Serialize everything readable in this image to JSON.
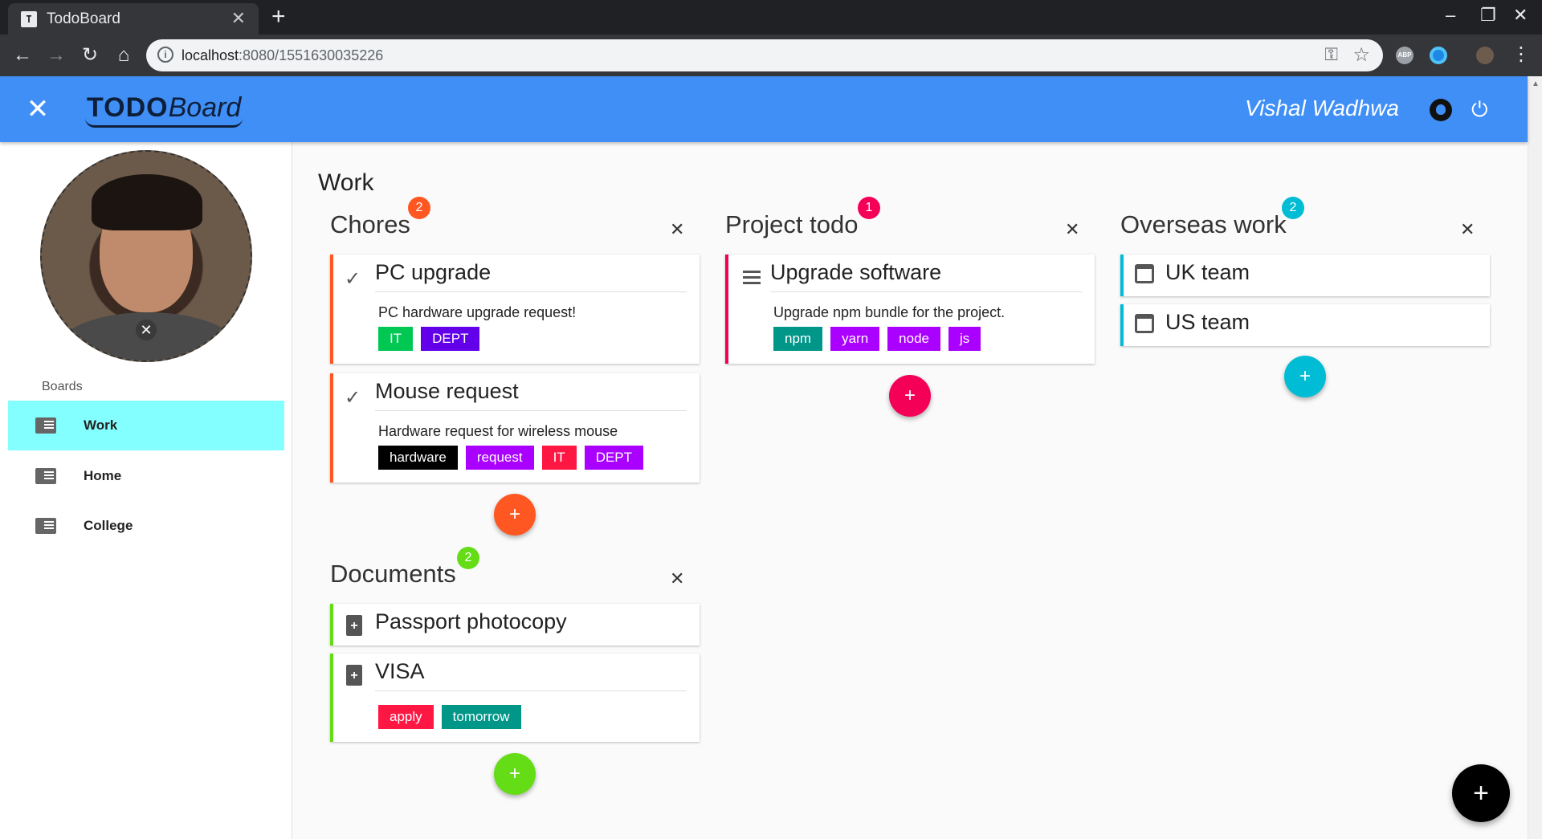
{
  "browser": {
    "tab_title": "TodoBoard",
    "url_host": "localhost",
    "url_path": ":8080/1551630035226"
  },
  "appbar": {
    "logo_bold": "TODO",
    "logo_italic": "Board",
    "username": "Vishal Wadhwa"
  },
  "sidebar": {
    "section_label": "Boards",
    "items": [
      {
        "label": "Work",
        "active": true
      },
      {
        "label": "Home",
        "active": false
      },
      {
        "label": "College",
        "active": false
      }
    ]
  },
  "board": {
    "title": "Work",
    "lists": [
      {
        "title": "Chores",
        "count": "2",
        "color": "#ff5722",
        "cards": [
          {
            "title": "PC upgrade",
            "icon": "check-icon",
            "description": "PC hardware upgrade request!",
            "tags": [
              {
                "label": "IT",
                "color": "#00c853"
              },
              {
                "label": "DEPT",
                "color": "#6200ea"
              }
            ]
          },
          {
            "title": "Mouse request",
            "icon": "check-icon",
            "description": "Hardware request for wireless mouse",
            "tags": [
              {
                "label": "hardware",
                "color": "#000000"
              },
              {
                "label": "request",
                "color": "#aa00ff"
              },
              {
                "label": "IT",
                "color": "#ff1744"
              },
              {
                "label": "DEPT",
                "color": "#aa00ff"
              }
            ]
          }
        ]
      },
      {
        "title": "Project todo",
        "count": "1",
        "color": "#f50057",
        "cards": [
          {
            "title": "Upgrade software",
            "icon": "list-icon",
            "description": "Upgrade npm bundle for the project.",
            "tags": [
              {
                "label": "npm",
                "color": "#009688"
              },
              {
                "label": "yarn",
                "color": "#aa00ff"
              },
              {
                "label": "node",
                "color": "#aa00ff"
              },
              {
                "label": "js",
                "color": "#aa00ff"
              }
            ]
          }
        ]
      },
      {
        "title": "Overseas work",
        "count": "2",
        "color": "#00bcd4",
        "cards": [
          {
            "title": "UK team",
            "icon": "calendar-icon"
          },
          {
            "title": "US team",
            "icon": "calendar-icon"
          }
        ]
      },
      {
        "title": "Documents",
        "count": "2",
        "color": "#64dd17",
        "cards": [
          {
            "title": "Passport photocopy",
            "icon": "document-icon"
          },
          {
            "title": "VISA",
            "icon": "document-icon",
            "tags": [
              {
                "label": "apply",
                "color": "#ff1744"
              },
              {
                "label": "tomorrow",
                "color": "#009688"
              }
            ]
          }
        ]
      }
    ]
  }
}
